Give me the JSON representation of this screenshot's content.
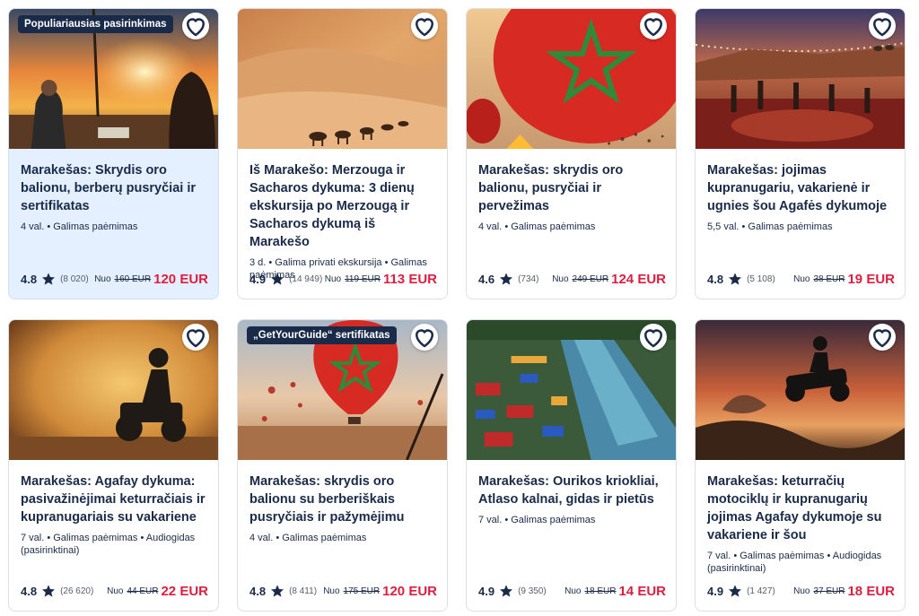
{
  "colors": {
    "navy": "#1a2b49",
    "price_red": "#dc1f40",
    "highlight_bg": "#e4efff"
  },
  "icons": {
    "favorite": "heart-outline-icon",
    "rating": "star-icon"
  },
  "cards": [
    {
      "badge": "Populiariausias pasirinkimas",
      "title": "Marakešas: Skrydis oro balionu, berberų pusryčiai ir sertifikatas",
      "meta": "4 val. • Galimas paėmimas",
      "rating": "4.8",
      "reviews": "(8 020)",
      "from": "Nuo",
      "old_price": "160 EUR",
      "price": "120 EUR",
      "image": "hot-air-balloon-sunrise-photo"
    },
    {
      "badge": "",
      "title": "Iš Marakešo: Merzouga ir Sacharos dykuma: 3 dienų ekskursija po Merzougą ir Sacharos dykumą iš Marakešo",
      "meta": "3 d. • Galima privati ekskursija • Galimas paėmimas",
      "rating": "4.9",
      "reviews": "(14 949)",
      "from": "Nuo",
      "old_price": "119 EUR",
      "price": "113 EUR",
      "image": "camel-caravan-sahara-photo"
    },
    {
      "badge": "",
      "title": "Marakešas: skrydis oro balionu, pusryčiai ir pervežimas",
      "meta": "4 val. • Galimas paėmimas",
      "rating": "4.6",
      "reviews": "(734)",
      "from": "Nuo",
      "old_price": "249 EUR",
      "price": "124 EUR",
      "image": "moroccan-flag-balloon-photo"
    },
    {
      "badge": "",
      "title": "Marakešas: jojimas kupranugariu, vakarienė ir ugnies šou Agafės dykumoje",
      "meta": "5,5 val. • Galimas paėmimas",
      "rating": "4.8",
      "reviews": "(5 108)",
      "from": "Nuo",
      "old_price": "38 EUR",
      "price": "19 EUR",
      "image": "desert-camp-dinner-photo"
    },
    {
      "badge": "",
      "title": "Marakešas: Agafay dykuma: pasivažinėjimai keturračiais ir kupranugariais su vakariene",
      "meta": "7 val. • Galimas paėmimas • Audiogidas (pasirinktinai)",
      "rating": "4.8",
      "reviews": "(26 620)",
      "from": "Nuo",
      "old_price": "44 EUR",
      "price": "22 EUR",
      "image": "quad-bike-dust-photo"
    },
    {
      "badge": "„GetYourGuide“ sertifikatas",
      "title": "Marakešas: skrydis oro balionu su berberiškais pusryčiais ir pažymėjimu",
      "meta": "4 val. • Galimas paėmimas",
      "rating": "4.8",
      "reviews": "(8 411)",
      "from": "Nuo",
      "old_price": "175 EUR",
      "price": "120 EUR",
      "image": "flag-balloon-over-desert-photo"
    },
    {
      "badge": "",
      "title": "Marakešas: Ourikos kriokliai, Atlaso kalnai, gidas ir pietūs",
      "meta": "7 val. • Galimas paėmimas",
      "rating": "4.9",
      "reviews": "(9 350)",
      "from": "Nuo",
      "old_price": "18 EUR",
      "price": "14 EUR",
      "image": "ourika-river-cafe-photo"
    },
    {
      "badge": "",
      "title": "Marakešas: keturračių motociklų ir kupranugarių jojimas Agafay dykumoje su vakariene ir šou",
      "meta": "7 val. • Galimas paėmimas • Audiogidas (pasirinktinai)",
      "rating": "4.9",
      "reviews": "(1 427)",
      "from": "Nuo",
      "old_price": "37 EUR",
      "price": "18 EUR",
      "image": "quad-bike-jump-sunset-photo"
    }
  ]
}
